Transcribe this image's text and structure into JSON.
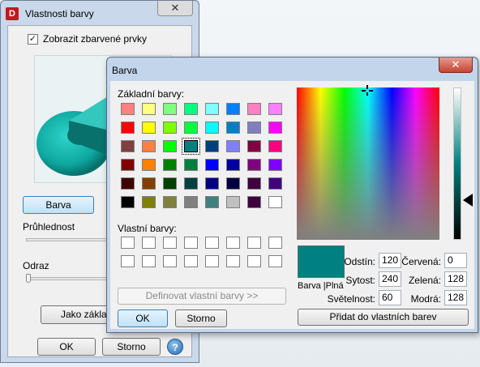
{
  "back_window": {
    "title": "Vlastnosti barvy",
    "close_glyph": "✕",
    "show_colored": {
      "label": "Zobrazit zbarvené prvky",
      "checked": true
    },
    "color_button": "Barva",
    "transparency_label": "Průhlednost",
    "reflection_label": "Odraz",
    "as_default_button": "Jako základ",
    "ok_button": "OK",
    "cancel_button": "Storno",
    "help_glyph": "?",
    "app_icon_letter": "D"
  },
  "dialog": {
    "title": "Barva",
    "close_glyph": "✕",
    "basic_colors_label": "Základní barvy:",
    "basic_colors": [
      [
        "#ff8080",
        "#ffff80",
        "#80ff80",
        "#00ff80",
        "#80ffff",
        "#0080ff",
        "#ff80c0",
        "#ff80ff"
      ],
      [
        "#ff0000",
        "#ffff00",
        "#80ff00",
        "#00ff40",
        "#00ffff",
        "#0080c0",
        "#8080c0",
        "#ff00ff"
      ],
      [
        "#804040",
        "#ff8040",
        "#00ff00",
        "#008080",
        "#004080",
        "#8080ff",
        "#800040",
        "#ff0080"
      ],
      [
        "#800000",
        "#ff8000",
        "#008000",
        "#008040",
        "#0000ff",
        "#0000a0",
        "#800080",
        "#8000ff"
      ],
      [
        "#400000",
        "#804000",
        "#004000",
        "#004040",
        "#000080",
        "#000040",
        "#400040",
        "#400080"
      ],
      [
        "#000000",
        "#808000",
        "#808040",
        "#808080",
        "#408080",
        "#c0c0c0",
        "#400040",
        "#ffffff"
      ]
    ],
    "selected_swatch": {
      "row": 2,
      "col": 3
    },
    "custom_colors_label": "Vlastní barvy:",
    "define_custom_button": "Definovat vlastní barvy >>",
    "ok_button": "OK",
    "cancel_button": "Storno",
    "color_solid_label": "Barva |Plná",
    "current_color": "#008080",
    "hue_label": "Odstín:",
    "hue": "120",
    "sat_label": "Sytost:",
    "sat": "240",
    "lum_label": "Světelnost:",
    "lum": "60",
    "red_label": "Červená:",
    "red": "0",
    "green_label": "Zelená:",
    "green": "128",
    "blue_label": "Modrá:",
    "blue": "128",
    "add_custom_button": "Přidat do vlastních barev"
  }
}
